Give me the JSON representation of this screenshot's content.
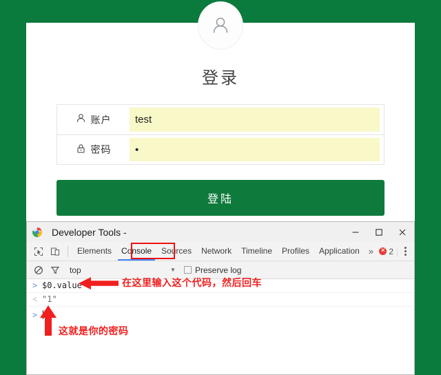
{
  "theme": {
    "page_green": "#0a7a3d",
    "button_green": "#0e7a3c",
    "autofill_yellow": "#f8f8c8",
    "annotation_red": "#f21f1f",
    "tab_active_blue": "#4285f4",
    "error_red": "#e53935"
  },
  "login": {
    "title": "登录",
    "avatar_icon": "user-avatar-icon",
    "fields": [
      {
        "key": "account",
        "icon": "user-icon",
        "label": "账户",
        "value": "test",
        "placeholder": ""
      },
      {
        "key": "password",
        "icon": "lock-icon",
        "label": "密码",
        "value": "•",
        "masked_char_count": 1,
        "placeholder": ""
      }
    ],
    "submit_label": "登陆"
  },
  "devtools": {
    "window_title": "Developer Tools -",
    "window_title_faded": "",
    "logo_icon": "chrome-devtools-logo-icon",
    "window_controls": [
      {
        "name": "minimize",
        "glyph": "—"
      },
      {
        "name": "maximize",
        "glyph": "▢"
      },
      {
        "name": "close",
        "glyph": "✕"
      }
    ],
    "tool_icons": [
      {
        "name": "inspect-element-icon"
      },
      {
        "name": "device-toolbar-icon"
      }
    ],
    "tabs": [
      {
        "label": "Elements",
        "active": false
      },
      {
        "label": "Console",
        "active": true
      },
      {
        "label": "Sources",
        "active": false
      },
      {
        "label": "Network",
        "active": false
      },
      {
        "label": "Timeline",
        "active": false
      },
      {
        "label": "Profiles",
        "active": false
      },
      {
        "label": "Application",
        "active": false
      }
    ],
    "more_tabs_glyph": "»",
    "error_count": "2",
    "console_toolbar": {
      "clear_icon": "clear-console-icon",
      "filter_icon": "filter-funnel-icon",
      "context": "top",
      "context_caret": "▼",
      "preserve_log_label": "Preserve log",
      "preserve_log_checked": false
    },
    "console_rows": [
      {
        "marker": ">",
        "type": "input",
        "text": "$0.value"
      },
      {
        "marker": "<",
        "type": "output",
        "text": "\"1\""
      }
    ],
    "console_prompt_marker": ">",
    "console_prompt_value": ""
  },
  "annotations": [
    {
      "id": "enter-code-here",
      "text": "在这里输入这个代码，然后回车",
      "arrow": "arrow-left"
    },
    {
      "id": "this-is-your-password",
      "text": "这就是你的密码",
      "arrow": "arrow-up"
    }
  ]
}
